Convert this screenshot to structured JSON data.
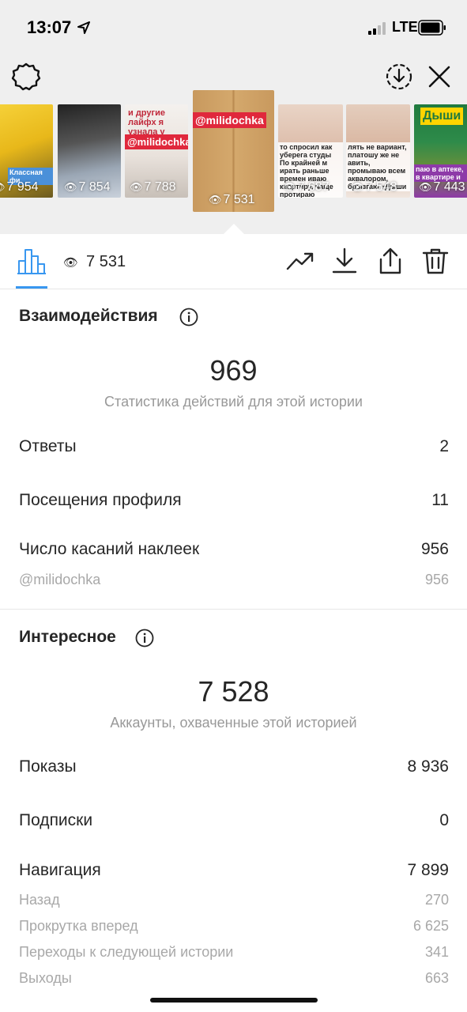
{
  "status_bar": {
    "time": "13:07",
    "network": "LTE"
  },
  "stories": [
    {
      "views": "7 954",
      "caption": "Классная фи"
    },
    {
      "views": "7 854",
      "caption": ""
    },
    {
      "views": "7 788",
      "caption": "и другие лайфх я узнала у",
      "tag": "@milidochka"
    },
    {
      "views": "7 531",
      "caption": "",
      "tag": "@milidochka",
      "selected": true
    },
    {
      "views": "7 687",
      "caption": "то спросил как уберега студы По крайней м ирать раньше времен иваю квартиру, чаще протираю пыль..."
    },
    {
      "views": "7 548",
      "caption": "лять не вариант, платошу же не авить, промываю всем аквалором, брызгаю «Дыши"
    },
    {
      "views": "7 443",
      "caption": "паю в аптеке, в квартире и",
      "tag": "Дыши"
    }
  ],
  "toolbar": {
    "views": "7 531"
  },
  "interactions": {
    "title": "Взаимодействия",
    "total": "969",
    "caption": "Статистика действий для этой истории",
    "rows": [
      {
        "label": "Ответы",
        "value": "2"
      },
      {
        "label": "Посещения профиля",
        "value": "11"
      },
      {
        "label": "Число касаний наклеек",
        "value": "956"
      }
    ],
    "sub_rows": [
      {
        "label": "@milidochka",
        "value": "956"
      }
    ]
  },
  "discovery": {
    "title": "Интересное",
    "total": "7 528",
    "caption": "Аккаунты, охваченные этой историей",
    "rows": [
      {
        "label": "Показы",
        "value": "8 936"
      },
      {
        "label": "Подписки",
        "value": "0"
      },
      {
        "label": "Навигация",
        "value": "7 899"
      }
    ],
    "nav_rows": [
      {
        "label": "Назад",
        "value": "270"
      },
      {
        "label": "Прокрутка вперед",
        "value": "6 625"
      },
      {
        "label": "Переходы к следующей истории",
        "value": "341"
      },
      {
        "label": "Выходы",
        "value": "663"
      }
    ]
  },
  "colors": {
    "accent": "#3897f0",
    "muted": "#999999"
  }
}
